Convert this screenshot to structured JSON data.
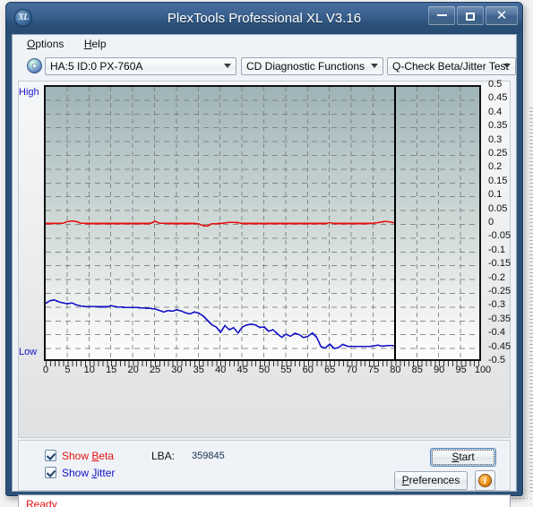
{
  "window": {
    "title": "PlexTools Professional XL V3.16",
    "app_icon": "XL",
    "minimize_label": "Minimize",
    "maximize_label": "Maximize",
    "close_label": "Close"
  },
  "menu": {
    "items": [
      {
        "label": "Options",
        "accel": "O"
      },
      {
        "label": "Help",
        "accel": "H"
      }
    ]
  },
  "toolbar": {
    "disc_icon": "disc-icon",
    "drive_select": "HA:5 ID:0  PX-760A",
    "function_select": "CD Diagnostic Functions",
    "test_select": "Q-Check Beta/Jitter Test"
  },
  "chart_labels": {
    "high": "High",
    "low": "Low"
  },
  "controls": {
    "show_beta": {
      "label": "Show Beta",
      "accel": "B",
      "checked": true,
      "color": "#e81010"
    },
    "show_jitter": {
      "label": "Show Jitter",
      "accel": "J",
      "checked": true,
      "color": "#1412c8"
    },
    "lba_label": "LBA:",
    "lba_value": "359845",
    "start_button": "Start",
    "start_accel": "S",
    "preferences_button": "Preferences",
    "preferences_accel": "P",
    "info_button": "i"
  },
  "statusbar": {
    "text": "Ready"
  },
  "background": {
    "col1": "488",
    "col2": "457",
    "col3": "3.59",
    "col4": "100"
  },
  "chart_data": {
    "type": "line",
    "title": "Q-Check Beta/Jitter Test",
    "xlabel": "",
    "ylabel": "",
    "xlim": [
      0,
      100
    ],
    "ylim": [
      -0.5,
      0.5
    ],
    "xticks": [
      0,
      5,
      10,
      15,
      20,
      25,
      30,
      35,
      40,
      45,
      50,
      55,
      60,
      65,
      70,
      75,
      80,
      85,
      90,
      95,
      100
    ],
    "yticks": [
      0.5,
      0.45,
      0.4,
      0.35,
      0.3,
      0.25,
      0.2,
      0.15,
      0.1,
      0.05,
      0,
      -0.05,
      -0.1,
      -0.15,
      -0.2,
      -0.25,
      -0.3,
      -0.35,
      -0.4,
      -0.45,
      -0.5
    ],
    "grid": true,
    "legend": "none",
    "axis_left_annotations": [
      "High",
      "Low"
    ],
    "progress_marker_x": 80,
    "series": [
      {
        "name": "Beta",
        "color": "#e81010",
        "x": [
          0,
          2,
          4,
          5,
          6,
          7,
          8,
          9,
          10,
          12,
          14,
          16,
          18,
          20,
          22,
          24,
          25,
          26,
          28,
          30,
          32,
          34,
          35,
          36,
          37,
          38,
          40,
          42,
          44,
          45,
          46,
          48,
          50,
          52,
          54,
          55,
          56,
          58,
          60,
          62,
          64,
          65,
          66,
          68,
          70,
          72,
          74,
          75,
          76,
          77,
          78,
          79,
          80
        ],
        "y": [
          0.005,
          0.005,
          0.006,
          0.012,
          0.014,
          0.012,
          0.006,
          0.005,
          0.005,
          0.005,
          0.005,
          0.005,
          0.005,
          0.005,
          0.005,
          0.005,
          0.013,
          0.006,
          0.005,
          0.005,
          0.005,
          0.005,
          0.004,
          -0.003,
          -0.004,
          0.004,
          0.005,
          0.009,
          0.008,
          0.005,
          0.005,
          0.005,
          0.005,
          0.005,
          0.005,
          0.005,
          0.005,
          0.005,
          0.005,
          0.005,
          0.005,
          0.008,
          0.005,
          0.005,
          0.005,
          0.005,
          0.005,
          0.006,
          0.008,
          0.011,
          0.012,
          0.01,
          0.006
        ]
      },
      {
        "name": "Jitter",
        "color": "#1412c8",
        "x": [
          0,
          1,
          2,
          3,
          4,
          5,
          6,
          7,
          8,
          9,
          10,
          11,
          12,
          13,
          14,
          15,
          16,
          17,
          18,
          19,
          20,
          21,
          22,
          23,
          24,
          25,
          26,
          27,
          28,
          29,
          30,
          31,
          32,
          33,
          34,
          35,
          36,
          37,
          38,
          39,
          40,
          41,
          42,
          43,
          44,
          45,
          46,
          47,
          48,
          49,
          50,
          51,
          52,
          53,
          54,
          55,
          56,
          57,
          58,
          59,
          60,
          61,
          62,
          63,
          64,
          65,
          66,
          67,
          68,
          69,
          70,
          71,
          72,
          73,
          74,
          75,
          76,
          77,
          78,
          79,
          80
        ],
        "y": [
          -0.285,
          -0.275,
          -0.272,
          -0.279,
          -0.283,
          -0.286,
          -0.283,
          -0.29,
          -0.294,
          -0.296,
          -0.296,
          -0.296,
          -0.297,
          -0.297,
          -0.297,
          -0.293,
          -0.297,
          -0.298,
          -0.299,
          -0.3,
          -0.3,
          -0.3,
          -0.301,
          -0.302,
          -0.303,
          -0.305,
          -0.31,
          -0.316,
          -0.311,
          -0.313,
          -0.308,
          -0.312,
          -0.319,
          -0.323,
          -0.316,
          -0.32,
          -0.33,
          -0.346,
          -0.362,
          -0.37,
          -0.39,
          -0.365,
          -0.38,
          -0.373,
          -0.392,
          -0.37,
          -0.363,
          -0.36,
          -0.363,
          -0.372,
          -0.37,
          -0.386,
          -0.38,
          -0.395,
          -0.408,
          -0.396,
          -0.404,
          -0.393,
          -0.398,
          -0.409,
          -0.404,
          -0.392,
          -0.408,
          -0.442,
          -0.446,
          -0.432,
          -0.448,
          -0.445,
          -0.433,
          -0.44,
          -0.441,
          -0.441,
          -0.441,
          -0.441,
          -0.441,
          -0.439,
          -0.436,
          -0.44,
          -0.438,
          -0.437,
          -0.44
        ]
      }
    ]
  }
}
